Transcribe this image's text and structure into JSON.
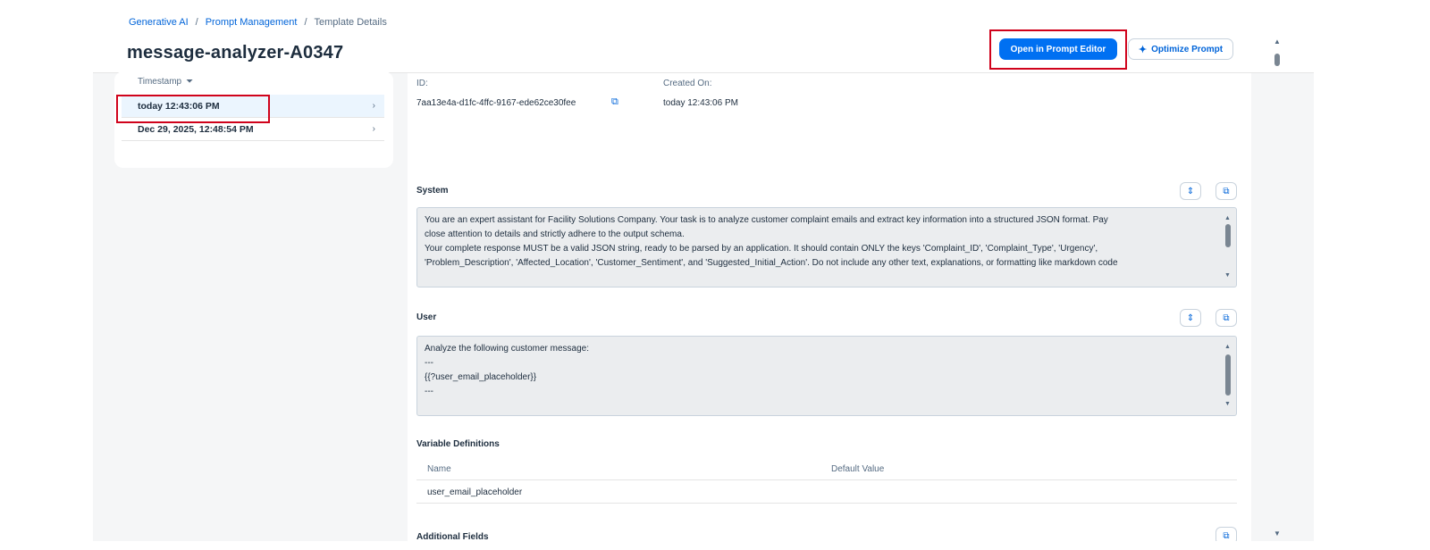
{
  "breadcrumb": {
    "items": [
      "Generative AI",
      "Prompt Management"
    ],
    "separator": "/",
    "current": "Template Details"
  },
  "page": {
    "title": "message-analyzer-A0347"
  },
  "actions": {
    "open_editor_label": "Open in Prompt Editor",
    "optimize_label": "Optimize Prompt"
  },
  "versions": {
    "column_header": "Timestamp",
    "rows": [
      {
        "label": "today 12:43:06 PM",
        "selected": true
      },
      {
        "label": "Dec 29, 2025, 12:48:54 PM",
        "selected": false
      }
    ]
  },
  "details": {
    "id_label": "ID:",
    "id_value": "7aa13e4a-d1fc-4ffc-9167-ede62ce30fee",
    "created_label": "Created On:",
    "created_value": "today 12:43:06 PM"
  },
  "system": {
    "title": "System",
    "lines": [
      "You are an expert assistant for Facility Solutions Company. Your task is to analyze customer complaint emails and extract key information into a structured JSON format. Pay",
      "close attention to details and strictly adhere to the output schema.",
      "",
      "Your complete response MUST be a valid JSON string, ready to be parsed by an application. It should contain ONLY the keys 'Complaint_ID', 'Complaint_Type', 'Urgency',",
      "'Problem_Description', 'Affected_Location', 'Customer_Sentiment', and 'Suggested_Initial_Action'. Do not include any other text, explanations, or formatting like markdown code"
    ]
  },
  "user": {
    "title": "User",
    "lines": [
      "Analyze the following customer message:",
      "---",
      "{{?user_email_placeholder}}",
      "---"
    ]
  },
  "variables": {
    "title": "Variable Definitions",
    "columns": [
      "Name",
      "Default Value"
    ],
    "rows": [
      {
        "name": "user_email_placeholder",
        "default": ""
      }
    ]
  },
  "additional": {
    "title": "Additional Fields"
  },
  "icons": {
    "filter": "filter-icon",
    "chevron": "chevron-right-icon",
    "copy": "copy-icon",
    "expand": "expand-collapse-icon",
    "sparkle": "sparkle-icon"
  },
  "colors": {
    "accent": "#0070f2",
    "highlight": "#d0021b",
    "selected_row": "#ebf5fe"
  }
}
